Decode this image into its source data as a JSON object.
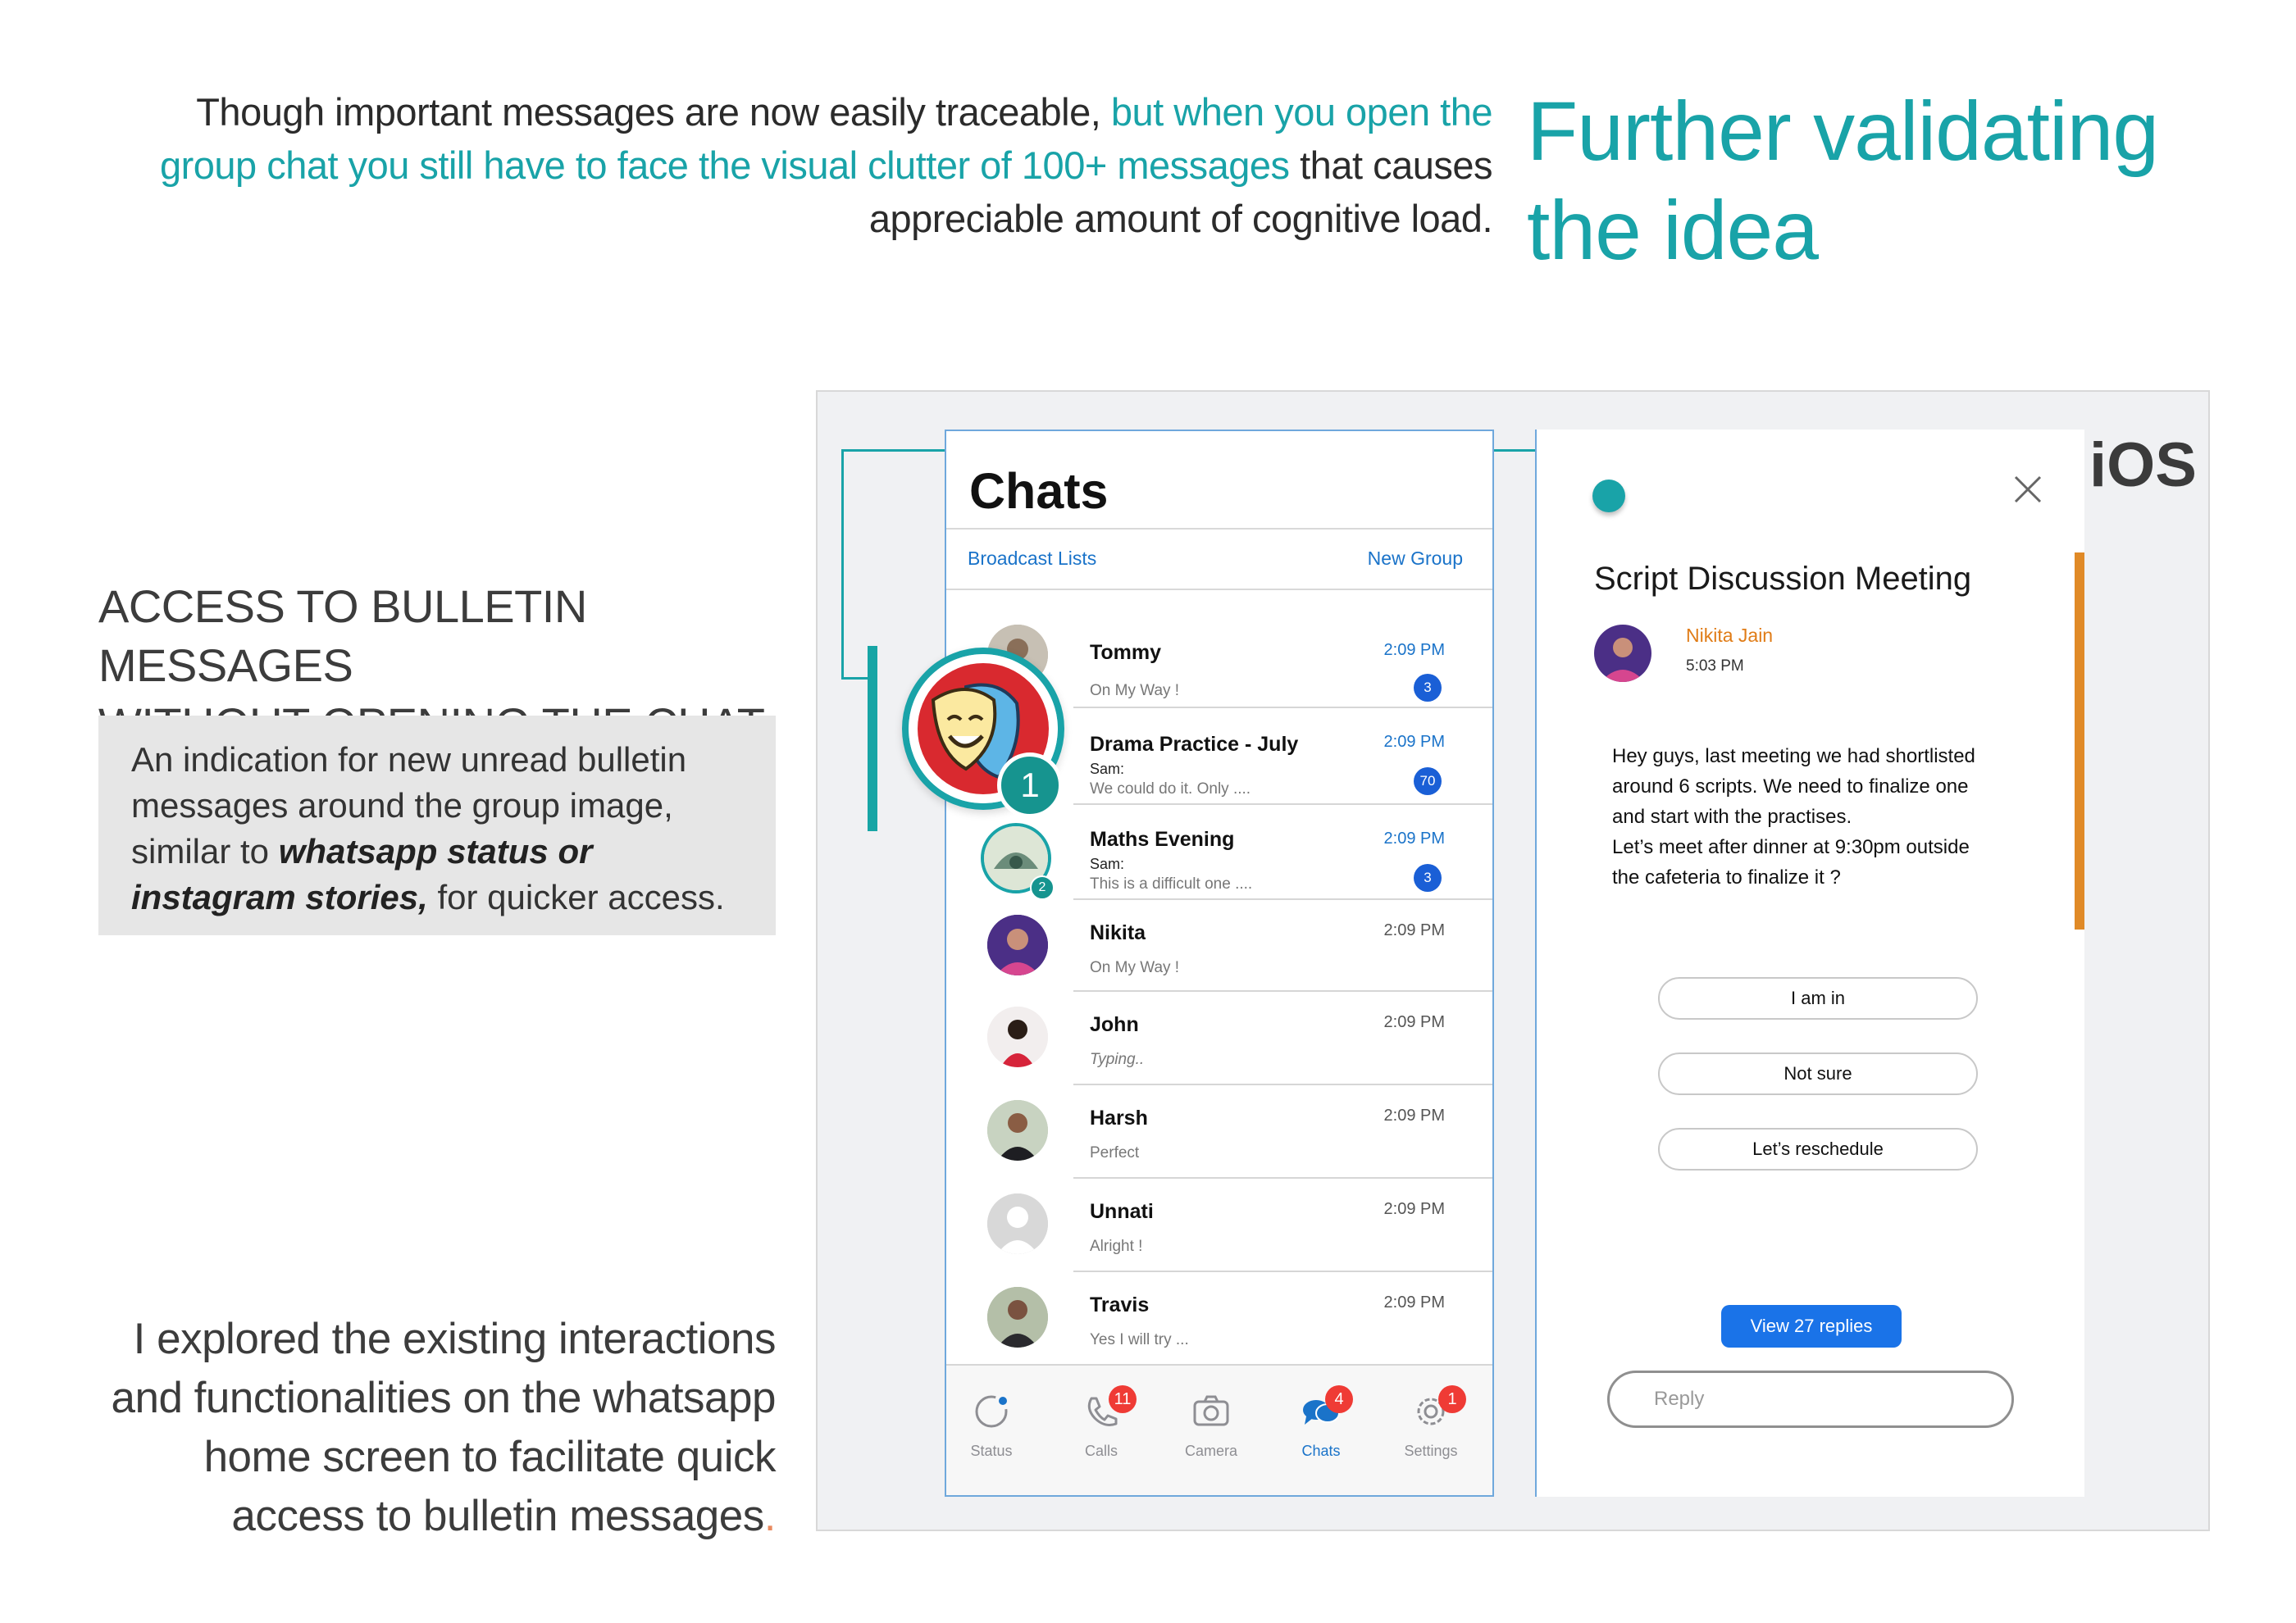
{
  "intro": {
    "part1": "Though important messages are now easily traceable,",
    "highlight": "but when you open the group chat you still have to face the visual clutter of 100+ messages",
    "part2": "that causes appreciable amount of cognitive load."
  },
  "headline": "Further validating the idea",
  "access": {
    "heading_line1": "ACCESS TO BULLETIN MESSAGES",
    "heading_line2": "WITHOUT OPENING THE CHAT",
    "callout_part1": "An indication for new unread bulletin messages around the group image, similar to",
    "callout_emphasis": "whatsapp status or instagram stories,",
    "callout_part2": "for quicker access."
  },
  "explore": {
    "text": "I explored the existing interactions and functionalities on the whatsapp home screen to facilitate quick access to bulletin messages",
    "end_mark": "."
  },
  "platform_label": "iOS",
  "chats_screen": {
    "title": "Chats",
    "broadcast_link": "Broadcast Lists",
    "new_group_link": "New Group",
    "group_badge": "1",
    "rows": [
      {
        "name": "Tommy",
        "sender": "",
        "preview": "On My Way !",
        "time": "2:09 PM",
        "unread": "3",
        "is_unread": true
      },
      {
        "name": "Drama Practice - July",
        "sender": "Sam:",
        "preview": "We could do it. Only ....",
        "time": "2:09 PM",
        "unread": "70",
        "is_unread": true
      },
      {
        "name": "Maths Evening",
        "sender": "Sam:",
        "preview": "This is a difficult one ....",
        "time": "2:09 PM",
        "unread": "3",
        "is_unread": true,
        "ring_badge": "2"
      },
      {
        "name": "Nikita",
        "sender": "",
        "preview": "On My Way !",
        "time": "2:09 PM",
        "unread": "",
        "is_unread": false
      },
      {
        "name": "John",
        "sender": "",
        "preview": "Typing..",
        "time": "2:09 PM",
        "unread": "",
        "is_unread": false
      },
      {
        "name": "Harsh",
        "sender": "",
        "preview": "Perfect",
        "time": "2:09 PM",
        "unread": "",
        "is_unread": false
      },
      {
        "name": "Unnati",
        "sender": "",
        "preview": "Alright !",
        "time": "2:09 PM",
        "unread": "",
        "is_unread": false
      },
      {
        "name": "Travis",
        "sender": "",
        "preview": "Yes I will try ...",
        "time": "2:09 PM",
        "unread": "",
        "is_unread": false
      }
    ],
    "tabs": [
      {
        "label": "Status",
        "icon": "status-icon",
        "badge": ""
      },
      {
        "label": "Calls",
        "icon": "phone-icon",
        "badge": "11"
      },
      {
        "label": "Camera",
        "icon": "camera-icon",
        "badge": ""
      },
      {
        "label": "Chats",
        "icon": "chat-bubbles-icon",
        "badge": "4",
        "active": true
      },
      {
        "label": "Settings",
        "icon": "gear-icon",
        "badge": "1"
      }
    ]
  },
  "bulletin": {
    "title": "Script Discussion Meeting",
    "author": "Nikita Jain",
    "time": "5:03 PM",
    "message_lines": [
      "Hey guys, last meeting we had shortlisted",
      "around 6 scripts. We need to finalize one",
      "and start with the practises.",
      "Let’s meet after dinner at 9:30pm outside",
      "the cafeteria to finalize it ?"
    ],
    "choices": [
      "I am in",
      "Not sure",
      "Let’s reschedule"
    ],
    "view_replies": "View 27 replies",
    "reply_placeholder": "Reply"
  },
  "colors": {
    "teal": "#19a3a8",
    "ios_blue": "#1a73c9",
    "badge_red": "#ef3b35",
    "accent_orange": "#e08a27"
  }
}
